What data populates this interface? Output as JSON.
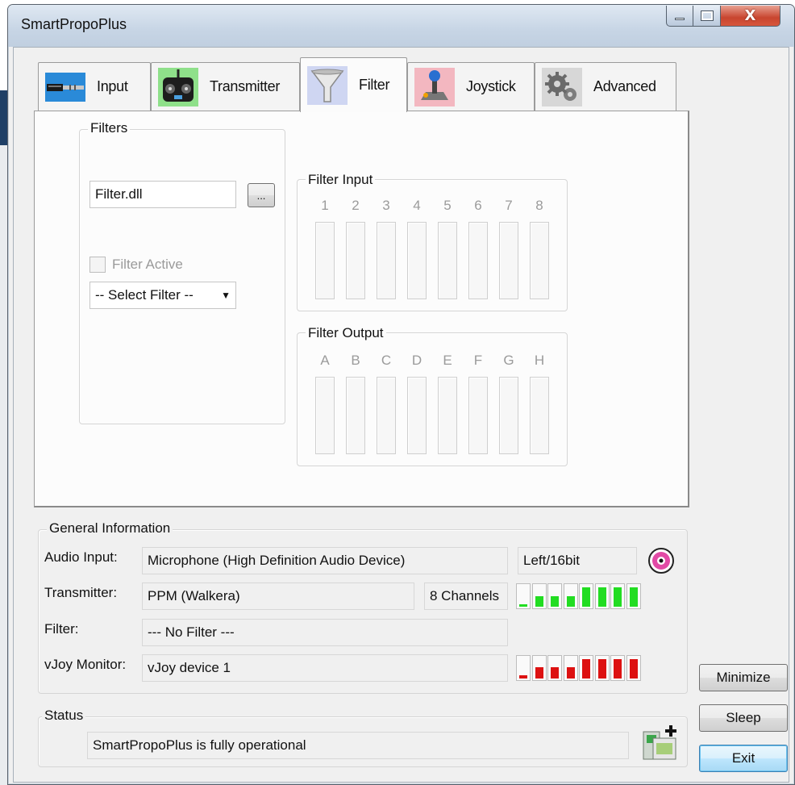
{
  "window": {
    "title": "SmartPropoPlus"
  },
  "tabs": [
    {
      "label": "Input",
      "icon": "audio-plug-icon"
    },
    {
      "label": "Transmitter",
      "icon": "rc-transmitter-icon"
    },
    {
      "label": "Filter",
      "icon": "funnel-icon"
    },
    {
      "label": "Joystick",
      "icon": "joystick-icon"
    },
    {
      "label": "Advanced",
      "icon": "gears-icon"
    }
  ],
  "filter_tab": {
    "filters_group": {
      "label": "Filters",
      "dll_value": "Filter.dll",
      "browse_label": "...",
      "active_checkbox_label": "Filter Active",
      "select_value": "-- Select Filter --"
    },
    "filter_input": {
      "label": "Filter Input",
      "channels": [
        "1",
        "2",
        "3",
        "4",
        "5",
        "6",
        "7",
        "8"
      ]
    },
    "filter_output": {
      "label": "Filter Output",
      "channels": [
        "A",
        "B",
        "C",
        "D",
        "E",
        "F",
        "G",
        "H"
      ]
    }
  },
  "general": {
    "label": "General Information",
    "audio_input": {
      "label": "Audio Input:",
      "value": "Microphone (High Definition Audio Device)",
      "format": "Left/16bit"
    },
    "transmitter": {
      "label": "Transmitter:",
      "value": "PPM (Walkera)",
      "channels": "8 Channels"
    },
    "filter": {
      "label": "Filter:",
      "value": "--- No Filter ---"
    },
    "vjoy": {
      "label": "vJoy Monitor:",
      "value": "vJoy device 1"
    },
    "transmitter_levels": [
      0.12,
      0.48,
      0.48,
      0.48,
      0.9,
      0.9,
      0.9,
      0.9
    ],
    "vjoy_levels": [
      0.16,
      0.5,
      0.5,
      0.5,
      0.9,
      0.9,
      0.9,
      0.9
    ],
    "colors": {
      "transmitter_meter": "#22dd22",
      "vjoy_meter": "#dd1111"
    }
  },
  "status": {
    "label": "Status",
    "text": "SmartPropoPlus is fully operational"
  },
  "buttons": {
    "minimize": "Minimize",
    "sleep": "Sleep",
    "exit": "Exit"
  }
}
